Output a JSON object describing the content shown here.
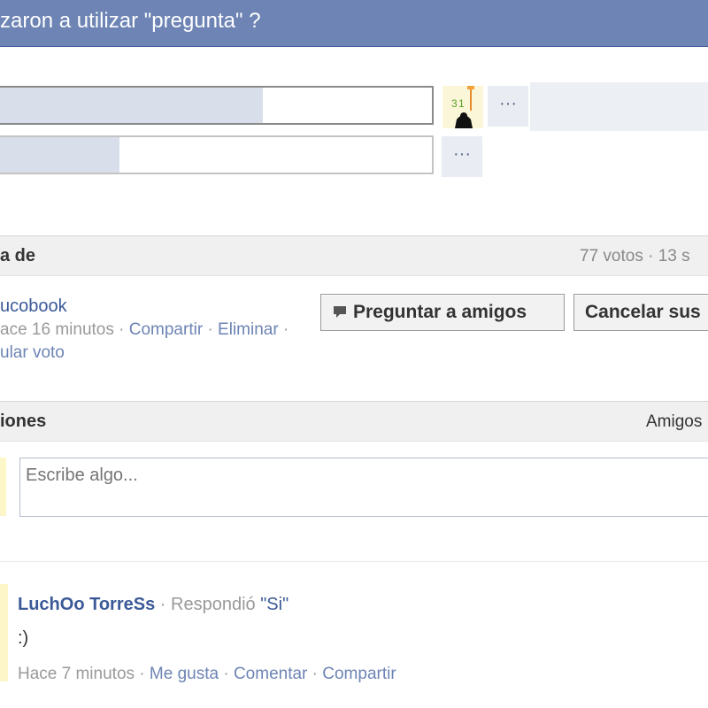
{
  "title": "zaron a utilizar \"pregunta\" ?",
  "poll": {
    "options": [
      {
        "fill_fraction": 0.61
      },
      {
        "fill_fraction": 0.28
      }
    ],
    "more_label": "···"
  },
  "info_section": {
    "header": "a de",
    "stats": "77 votos · 13 s",
    "author": "ucobook",
    "meta": {
      "time": "ace 16 minutos",
      "share": "Compartir",
      "delete": "Eliminar",
      "sep": "·",
      "undo": "ular voto"
    },
    "ask_friends_label": "Preguntar a amigos",
    "cancel_label": "Cancelar sus"
  },
  "answers_section": {
    "header": "iones",
    "filter": "Amigos",
    "comment_placeholder": "Escribe algo...",
    "comments": [
      {
        "author": "LuchOo TorreSs",
        "separator": "·",
        "action": "Respondió",
        "answer": "\"Si\"",
        "text": ":)",
        "time": "Hace 7 minutos",
        "like": "Me gusta",
        "comment": "Comentar",
        "share": "Compartir"
      }
    ]
  },
  "colors": {
    "title_bar": "#6d84b4",
    "link": "#3b5998",
    "poll_fill": "#d8dfea"
  }
}
